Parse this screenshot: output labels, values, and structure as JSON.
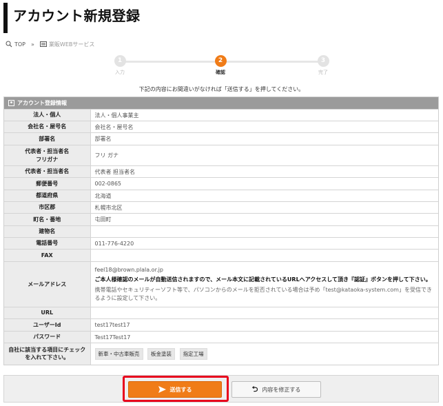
{
  "page": {
    "title": "アカウント新規登録"
  },
  "breadcrumb": {
    "home": "TOP",
    "separator": "»",
    "current": "業販WEBサービス"
  },
  "steps": [
    {
      "num": "1",
      "label": "入力"
    },
    {
      "num": "2",
      "label": "確認"
    },
    {
      "num": "3",
      "label": "完了"
    }
  ],
  "instruction": "下記の内容にお間違いがなければ「送信する」を押してください。",
  "form": {
    "header": "アカウント登録情報",
    "rows": {
      "type": {
        "label": "法人・個人",
        "value": "法人・個人事業主"
      },
      "company": {
        "label": "会社名・屋号名",
        "value": "会社名・屋号名"
      },
      "dept": {
        "label": "部署名",
        "value": "部署名"
      },
      "kana": {
        "label1": "代表者・担当者名",
        "label2": "フリガナ",
        "value": "フリ ガナ"
      },
      "rep": {
        "label": "代表者・担当者名",
        "value": "代表者 担当者名"
      },
      "zip": {
        "label": "郵便番号",
        "value": "002-0865"
      },
      "pref": {
        "label": "都道府県",
        "value": "北海道"
      },
      "city": {
        "label": "市区郡",
        "value": "札幌市北区"
      },
      "town": {
        "label": "町名・番地",
        "value": "屯田町"
      },
      "building": {
        "label": "建物名",
        "value": ""
      },
      "tel": {
        "label": "電話番号",
        "value": "011-776-4220"
      },
      "fax": {
        "label": "FAX",
        "value": ""
      },
      "email": {
        "label": "メールアドレス",
        "value": "feel18@brown.plala.or.jp",
        "notice": "ご本人様確認のメールが自動送信されますので、メール本文に記載されているURLへアクセスして頂き『認証』ボタンを押して下さい。",
        "note": "携帯電話やセキュリティーソフト等で、パソコンからのメールを拒否されている場合は予め「test@kataoka-system.com」を受信できるように設定して下さい。"
      },
      "url": {
        "label": "URL",
        "value": ""
      },
      "userid": {
        "label": "ユーザーId",
        "value": "test17test17"
      },
      "password": {
        "label": "パスワード",
        "value": "Test17Test17"
      },
      "check": {
        "label1": "自社に該当する項目にチェック",
        "label2": "を入れて下さい。",
        "tags": [
          "新車・中古車販売",
          "板金塗装",
          "指定工場"
        ]
      }
    }
  },
  "buttons": {
    "send": "送信する",
    "fix": "内容を修正する"
  },
  "colors": {
    "accent": "#f07c18",
    "highlight": "#e8001c",
    "header_bg": "#9b9b9b"
  }
}
